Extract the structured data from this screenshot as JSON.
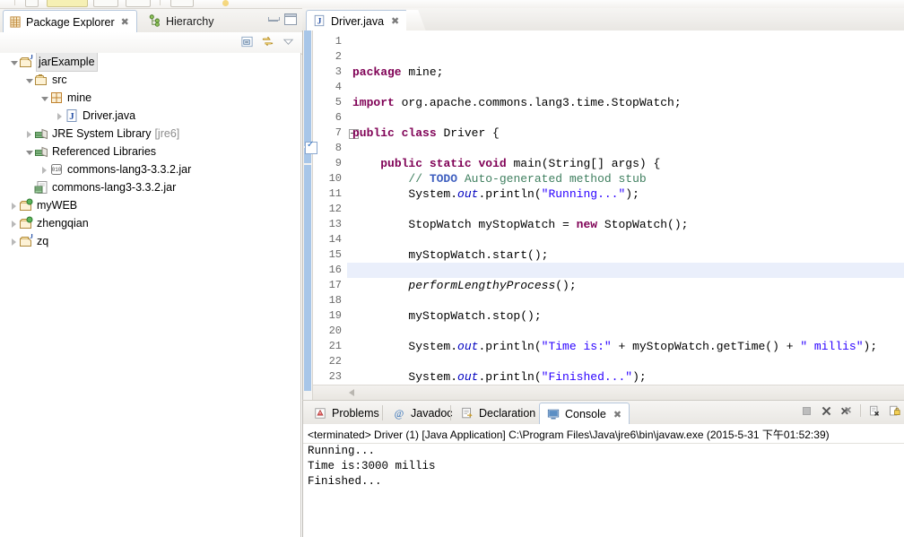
{
  "window": {
    "left_view": {
      "tabs": [
        {
          "label": "Package Explorer",
          "icon": "package-explorer-icon",
          "active": true,
          "closeable": true
        },
        {
          "label": "Hierarchy",
          "icon": "hierarchy-icon",
          "active": false,
          "closeable": false
        }
      ],
      "close_glyph": "✖",
      "toolbar": [
        {
          "name": "collapse-all-icon",
          "tooltip": "Collapse All"
        },
        {
          "name": "link-with-editor-icon",
          "tooltip": "Link with Editor"
        },
        {
          "name": "view-menu-icon",
          "tooltip": "View Menu"
        }
      ],
      "window_buttons": [
        {
          "name": "minimize-button"
        },
        {
          "name": "maximize-button"
        }
      ]
    },
    "tree": {
      "nodes": [
        {
          "label": "jarExample",
          "icon": "java-project-icon",
          "indent": 0,
          "arrow": "expanded",
          "selected": true,
          "suffix": ""
        },
        {
          "label": "src",
          "icon": "source-folder-icon",
          "indent": 1,
          "arrow": "expanded",
          "selected": false,
          "suffix": ""
        },
        {
          "label": "mine",
          "icon": "package-icon",
          "indent": 2,
          "arrow": "expanded",
          "selected": false,
          "suffix": ""
        },
        {
          "label": "Driver.java",
          "icon": "java-file-icon",
          "indent": 3,
          "arrow": "collapsed",
          "selected": false,
          "suffix": ""
        },
        {
          "label": "JRE System Library",
          "icon": "library-icon",
          "indent": 1,
          "arrow": "collapsed",
          "selected": false,
          "suffix": "[jre6]"
        },
        {
          "label": "Referenced Libraries",
          "icon": "library-icon",
          "indent": 1,
          "arrow": "expanded",
          "selected": false,
          "suffix": ""
        },
        {
          "label": "commons-lang3-3.3.2.jar",
          "icon": "jar-icon",
          "indent": 2,
          "arrow": "collapsed",
          "selected": false,
          "suffix": ""
        },
        {
          "label": "commons-lang3-3.3.2.jar",
          "icon": "jar-file-icon",
          "indent": 1,
          "arrow": "none",
          "selected": false,
          "suffix": ""
        },
        {
          "label": "myWEB",
          "icon": "project-icon",
          "indent": 0,
          "arrow": "collapsed",
          "selected": false,
          "suffix": ""
        },
        {
          "label": "zhengqian",
          "icon": "project-icon",
          "indent": 0,
          "arrow": "collapsed",
          "selected": false,
          "suffix": ""
        },
        {
          "label": "zq",
          "icon": "java-project-icon",
          "indent": 0,
          "arrow": "collapsed",
          "selected": false,
          "suffix": ""
        }
      ]
    },
    "editor": {
      "tab": {
        "label": "Driver.java",
        "icon": "java-file-icon",
        "close_glyph": "✖",
        "active": true
      },
      "current_line": 14,
      "folding_line": 7,
      "task_marker_line": 8,
      "lines": [
        {
          "n": 1,
          "tokens": [
            {
              "t": "kw",
              "v": "package"
            },
            {
              "t": "p",
              "v": " mine;"
            }
          ]
        },
        {
          "n": 2,
          "tokens": []
        },
        {
          "n": 3,
          "tokens": [
            {
              "t": "kw",
              "v": "import"
            },
            {
              "t": "p",
              "v": " org.apache.commons.lang3.time.StopWatch;"
            }
          ]
        },
        {
          "n": 4,
          "tokens": []
        },
        {
          "n": 5,
          "tokens": [
            {
              "t": "kw",
              "v": "public"
            },
            {
              "t": "p",
              "v": " "
            },
            {
              "t": "kw",
              "v": "class"
            },
            {
              "t": "p",
              "v": " Driver {"
            }
          ]
        },
        {
          "n": 6,
          "tokens": []
        },
        {
          "n": 7,
          "tokens": [
            {
              "t": "p",
              "v": "    "
            },
            {
              "t": "kw",
              "v": "public"
            },
            {
              "t": "p",
              "v": " "
            },
            {
              "t": "kw",
              "v": "static"
            },
            {
              "t": "p",
              "v": " "
            },
            {
              "t": "kw",
              "v": "void"
            },
            {
              "t": "p",
              "v": " main(String[] args) {"
            }
          ]
        },
        {
          "n": 8,
          "tokens": [
            {
              "t": "p",
              "v": "        "
            },
            {
              "t": "cmt",
              "v": "// "
            },
            {
              "t": "todo",
              "v": "TODO"
            },
            {
              "t": "cmt",
              "v": " Auto-generated method stub"
            }
          ]
        },
        {
          "n": 9,
          "tokens": [
            {
              "t": "p",
              "v": "        System."
            },
            {
              "t": "fld",
              "v": "out"
            },
            {
              "t": "p",
              "v": ".println("
            },
            {
              "t": "str",
              "v": "\"Running...\""
            },
            {
              "t": "p",
              "v": ");"
            }
          ]
        },
        {
          "n": 10,
          "tokens": []
        },
        {
          "n": 11,
          "tokens": [
            {
              "t": "p",
              "v": "        StopWatch myStopWatch = "
            },
            {
              "t": "kw",
              "v": "new"
            },
            {
              "t": "p",
              "v": " StopWatch();"
            }
          ]
        },
        {
          "n": 12,
          "tokens": []
        },
        {
          "n": 13,
          "tokens": [
            {
              "t": "p",
              "v": "        myStopWatch.start();"
            }
          ]
        },
        {
          "n": 14,
          "tokens": []
        },
        {
          "n": 15,
          "tokens": [
            {
              "t": "p",
              "v": "        "
            },
            {
              "t": "mth",
              "v": "performLengthyProcess"
            },
            {
              "t": "p",
              "v": "();"
            }
          ]
        },
        {
          "n": 16,
          "tokens": []
        },
        {
          "n": 17,
          "tokens": [
            {
              "t": "p",
              "v": "        myStopWatch.stop();"
            }
          ]
        },
        {
          "n": 18,
          "tokens": []
        },
        {
          "n": 19,
          "tokens": [
            {
              "t": "p",
              "v": "        System."
            },
            {
              "t": "fld",
              "v": "out"
            },
            {
              "t": "p",
              "v": ".println("
            },
            {
              "t": "str",
              "v": "\"Time is:\""
            },
            {
              "t": "p",
              "v": " + myStopWatch.getTime() + "
            },
            {
              "t": "str",
              "v": "\" millis\""
            },
            {
              "t": "p",
              "v": ");"
            }
          ]
        },
        {
          "n": 20,
          "tokens": []
        },
        {
          "n": 21,
          "tokens": [
            {
              "t": "p",
              "v": "        System."
            },
            {
              "t": "fld",
              "v": "out"
            },
            {
              "t": "p",
              "v": ".println("
            },
            {
              "t": "str",
              "v": "\"Finished...\""
            },
            {
              "t": "p",
              "v": ");"
            }
          ]
        },
        {
          "n": 22,
          "tokens": []
        },
        {
          "n": 23,
          "tokens": [
            {
              "t": "p",
              "v": "    }"
            }
          ]
        }
      ]
    },
    "bottom_view": {
      "tabs": [
        {
          "label": "Problems",
          "icon": "problems-icon",
          "active": false,
          "closeable": false
        },
        {
          "label": "Javadoc",
          "icon": "javadoc-icon",
          "active": false,
          "closeable": false
        },
        {
          "label": "Declaration",
          "icon": "declaration-icon",
          "active": false,
          "closeable": false
        },
        {
          "label": "Console",
          "icon": "console-icon",
          "active": true,
          "closeable": true
        }
      ],
      "close_glyph": "✖",
      "toolbar": [
        {
          "name": "terminate-icon",
          "tooltip": "Terminate"
        },
        {
          "name": "remove-launch-icon",
          "tooltip": "Remove Launch"
        },
        {
          "name": "remove-all-terminated-icon",
          "tooltip": "Remove All Terminated Launches"
        },
        {
          "name": "clear-console-icon",
          "tooltip": "Clear Console"
        },
        {
          "name": "scroll-lock-icon",
          "tooltip": "Scroll Lock"
        }
      ],
      "console": {
        "header": "<terminated> Driver (1) [Java Application] C:\\Program Files\\Java\\jre6\\bin\\javaw.exe (2015-5-31 下午01:52:39)",
        "lines": [
          "Running...",
          "Time is:3000 millis",
          "Finished..."
        ]
      }
    }
  },
  "colors": {
    "keyword": "#7f0055",
    "string": "#2a00ff",
    "comment": "#3f7f5f",
    "todo": "#3f5fbf",
    "field": "#0000c0",
    "tab_border": "#b6c7dd",
    "current_line": "#eaeffb"
  }
}
